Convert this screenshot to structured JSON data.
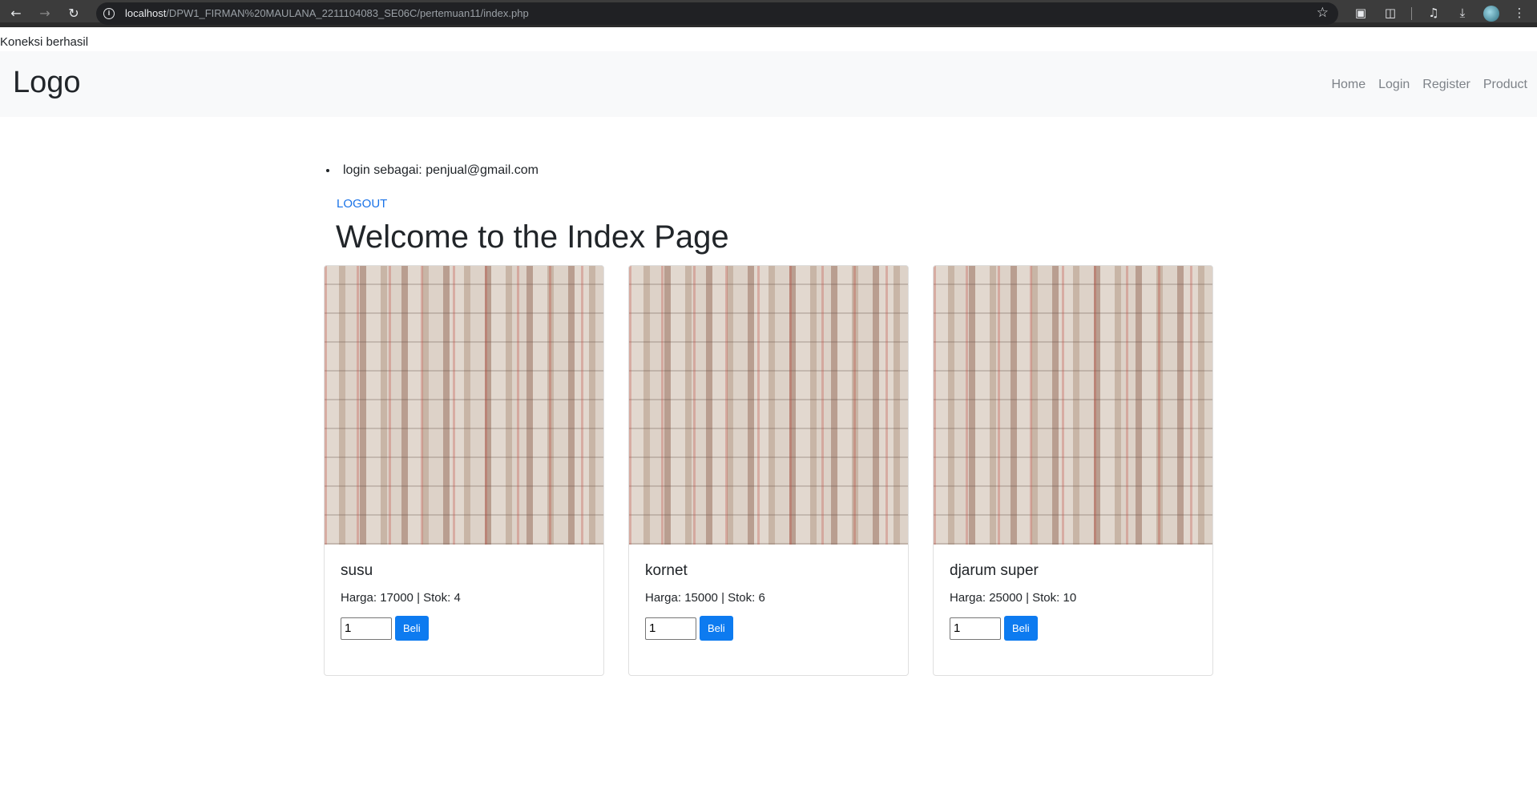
{
  "browser": {
    "url_host": "localhost",
    "url_path": "/DPW1_FIRMAN%20MAULANA_2211104083_SE06C/pertemuan11/index.php",
    "icons": [
      "back-icon",
      "forward-icon",
      "reload-icon",
      "info-icon",
      "star-icon",
      "extension-icon",
      "puzzle-icon",
      "media-icon",
      "download-icon",
      "profile-icon",
      "menu-icon"
    ]
  },
  "page": {
    "connection_status": "Koneksi berhasil",
    "navbar": {
      "brand": "Logo",
      "links": [
        "Home",
        "Login",
        "Register",
        "Product"
      ]
    },
    "user_info": "login sebagai: penjual@gmail.com",
    "logout_label": "LOGOUT",
    "title": "Welcome to the Index Page",
    "products": [
      {
        "name": "susu",
        "info": "Harga: 17000 | Stok: 4",
        "qty": "1",
        "button": "Beli"
      },
      {
        "name": "kornet",
        "info": "Harga: 15000 | Stok: 6",
        "qty": "1",
        "button": "Beli"
      },
      {
        "name": "djarum super",
        "info": "Harga: 25000 | Stok: 10",
        "qty": "1",
        "button": "Beli"
      }
    ]
  }
}
